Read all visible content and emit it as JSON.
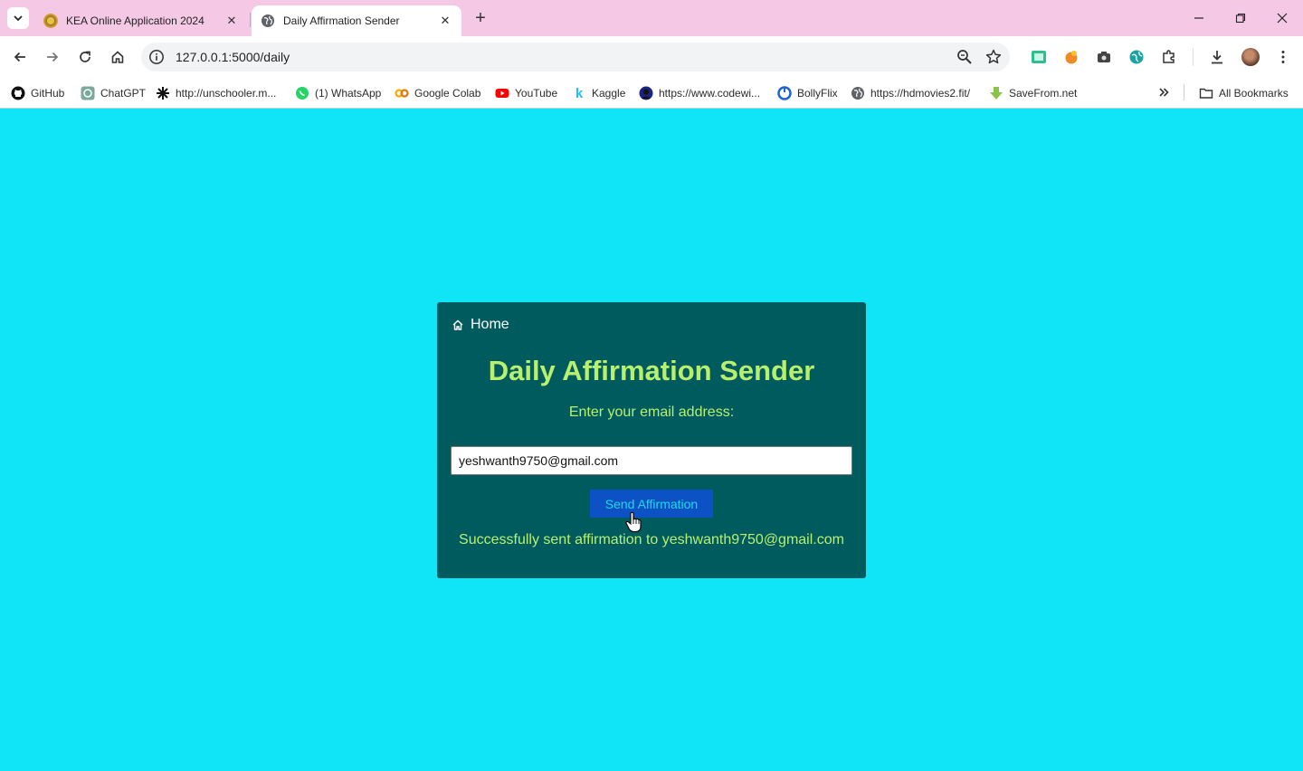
{
  "browser": {
    "tabs": [
      {
        "title": "KEA Online Application 2024",
        "active": false,
        "favicon": "kea-emblem-icon"
      },
      {
        "title": "Daily Affirmation Sender",
        "active": true,
        "favicon": "globe-icon"
      }
    ],
    "url": "127.0.0.1:5000/daily",
    "bookmarks": [
      {
        "label": "GitHub",
        "icon": "github-icon"
      },
      {
        "label": "ChatGPT",
        "icon": "chatgpt-icon"
      },
      {
        "label": "http://unschooler.m...",
        "icon": "star-burst-icon"
      },
      {
        "label": "(1) WhatsApp",
        "icon": "whatsapp-icon"
      },
      {
        "label": "Google Colab",
        "icon": "colab-icon"
      },
      {
        "label": "YouTube",
        "icon": "youtube-icon"
      },
      {
        "label": "Kaggle",
        "icon": "kaggle-icon"
      },
      {
        "label": "https://www.codewi...",
        "icon": "codewithharry-icon"
      },
      {
        "label": "BollyFlix",
        "icon": "bollyflix-icon"
      },
      {
        "label": "https://hdmovies2.fit/",
        "icon": "globe-icon"
      },
      {
        "label": "SaveFrom.net",
        "icon": "savefrom-icon"
      }
    ],
    "all_bookmarks_label": "All Bookmarks"
  },
  "page": {
    "home_label": "Home",
    "title": "Daily Affirmation Sender",
    "email_label": "Enter your email address:",
    "email_value": "yeshwanth9750@gmail.com",
    "send_button": "Send Affirmation",
    "success_message": "Successfully sent affirmation to yeshwanth9750@gmail.com"
  },
  "colors": {
    "page_background": "#10e5f8",
    "card_background": "#005b5e",
    "title_color": "#b8f06e",
    "button_background": "#0c52c4",
    "button_text": "#20d8e6",
    "tabstrip": "#f5c9e6"
  }
}
